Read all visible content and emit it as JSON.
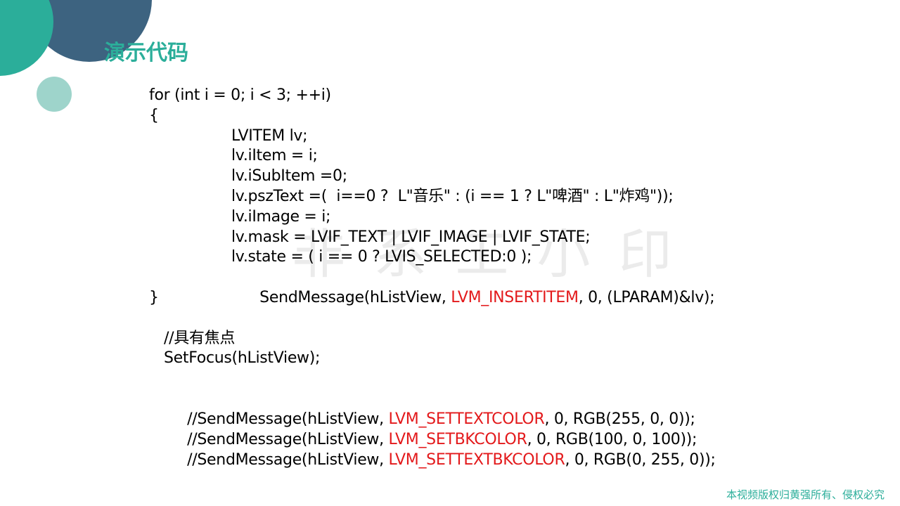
{
  "slide": {
    "title": "演示代码",
    "copyright": "本视频版权归黄强所有、侵权必究",
    "watermark": "非 系 工 小 印",
    "colors": {
      "accent_teal": "#2bae9a",
      "accent_dark": "#3d6380",
      "accent_light": "#9ed4cb",
      "highlight_red": "#e3191b"
    }
  },
  "code": {
    "line1": "for (int i = 0; i < 3; ++i)",
    "line2": "{",
    "line3": "LVITEM lv;",
    "line4": "lv.iItem = i;",
    "line5": "lv.iSubItem =0;",
    "line6": "lv.pszText =(  i==0 ?  L\"音乐\" : (i == 1 ? L\"啤酒\" : L\"炸鸡\"));",
    "line7": "lv.iImage = i;",
    "line8": "lv.mask = LVIF_TEXT | LVIF_IMAGE | LVIF_STATE;",
    "line9": "lv.state = ( i == 0 ? LVIS_SELECTED:0 );",
    "line10": {
      "pre": "SendMessage(hListView, ",
      "hl": "LVM_INSERTITEM",
      "post": ", 0, (LPARAM)&lv);"
    },
    "line11": "}",
    "line12": "//具有焦点",
    "line13": "SetFocus(hListView);",
    "line14": {
      "pre": "//SendMessage(hListView, ",
      "hl": "LVM_SETTEXTCOLOR",
      "post": ", 0, RGB(255, 0, 0));"
    },
    "line15": {
      "pre": "//SendMessage(hListView, ",
      "hl": "LVM_SETBKCOLOR",
      "post": ", 0, RGB(100, 0, 100));"
    },
    "line16": {
      "pre": "//SendMessage(hListView, ",
      "hl": "LVM_SETTEXTBKCOLOR",
      "post": ", 0, RGB(0, 255, 0));"
    }
  }
}
